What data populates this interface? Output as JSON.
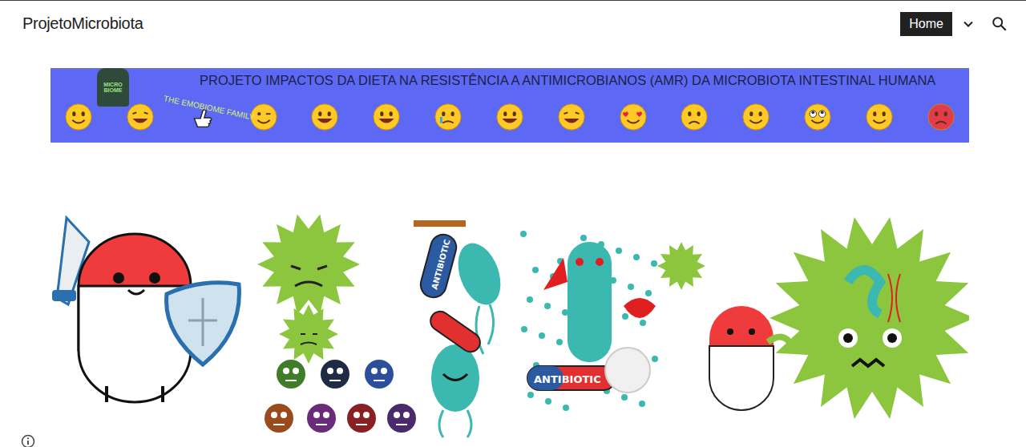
{
  "site": {
    "title": "ProjetoMicrobiota"
  },
  "nav": {
    "items": [
      {
        "label": "Home",
        "selected": true
      }
    ]
  },
  "banner": {
    "title": "PROJETO IMPACTOS DA DIETA NA RESISTÊNCIA A ANTIMICROBIANOS (AMR) DA MICROBIOTA INTESTINAL HUMANA",
    "logo_lines": [
      "MICRO",
      "BIOME"
    ],
    "logo_caption": "THE EMOBIOME FAMILY"
  },
  "illustration": {
    "labels": [
      "ANTIBIOTIC",
      "ANTIBIOTIC"
    ]
  }
}
